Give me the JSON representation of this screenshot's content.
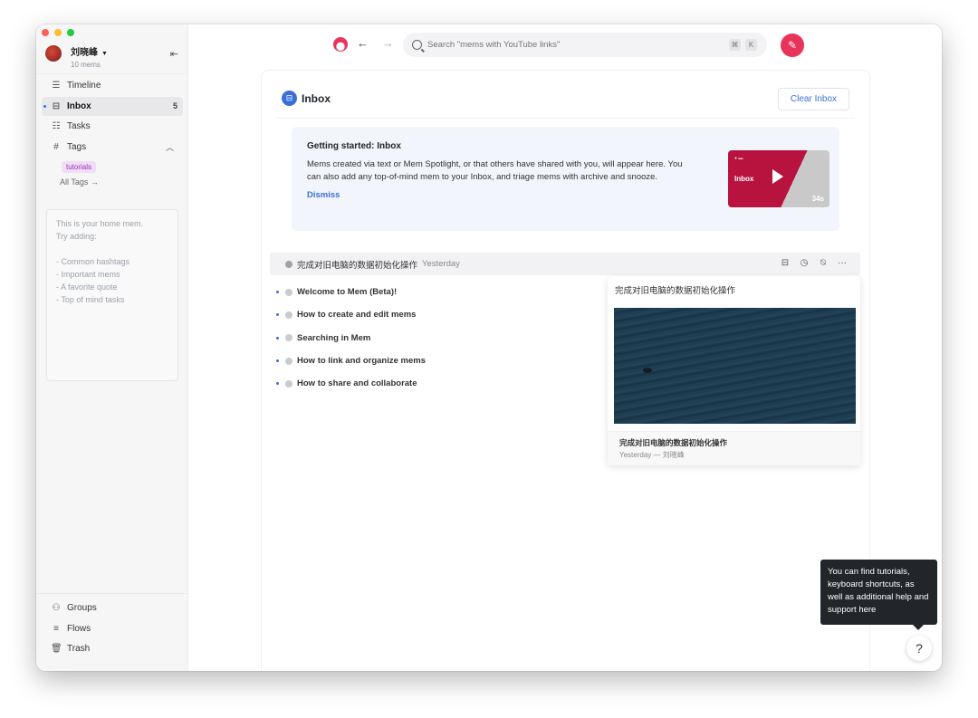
{
  "user": {
    "name": "刘晓峰",
    "mem_count": "10 mems"
  },
  "sidebar": {
    "items": [
      {
        "label": "Timeline",
        "icon": "timeline-icon"
      },
      {
        "label": "Inbox",
        "icon": "inbox-icon",
        "count": "5"
      },
      {
        "label": "Tasks",
        "icon": "tasks-icon"
      },
      {
        "label": "Tags",
        "icon": "hash-icon"
      }
    ],
    "tag_chip": "tutorials",
    "all_tags": "All Tags →",
    "home_mem": {
      "intro1": "This is your home mem.",
      "intro2": "Try adding:",
      "lines": [
        "- Common hashtags",
        "- Important mems",
        "- A favorite quote",
        "- Top of mind tasks"
      ]
    },
    "bottom": [
      {
        "label": "Groups",
        "icon": "groups-icon"
      },
      {
        "label": "Flows",
        "icon": "flows-icon"
      },
      {
        "label": "Trash",
        "icon": "trash-icon"
      }
    ]
  },
  "search": {
    "placeholder": "Search \"mems with YouTube links\"",
    "key1": "⌘",
    "key2": "K"
  },
  "inbox": {
    "title": "Inbox",
    "clear_label": "Clear Inbox",
    "getting_started": {
      "title": "Getting started: Inbox",
      "body": "Mems created via text or Mem Spotlight, or that others have shared with you, will appear here. You can also add any top-of-mind mem to your Inbox, and triage mems with archive and snooze.",
      "dismiss": "Dismiss",
      "video_label": "Inbox",
      "video_duration": "34s"
    },
    "mem_row": {
      "title": "完成对旧电脑的数据初始化操作",
      "date": "Yesterday"
    },
    "list": [
      "Welcome to Mem (Beta)!",
      "How to create and edit mems",
      "Searching in Mem",
      "How to link and organize mems",
      "How to share and collaborate"
    ],
    "preview": {
      "title": "完成对旧电脑的数据初始化操作",
      "foot_title": "完成对旧电脑的数据初始化操作",
      "foot_meta": "Yesterday — 刘晓峰"
    }
  },
  "tooltip": "You can find tutorials, keyboard shortcuts, as well as additional help and support here",
  "help_label": "?",
  "colors": {
    "accent": "#e8335b",
    "link": "#3b6fd8"
  }
}
